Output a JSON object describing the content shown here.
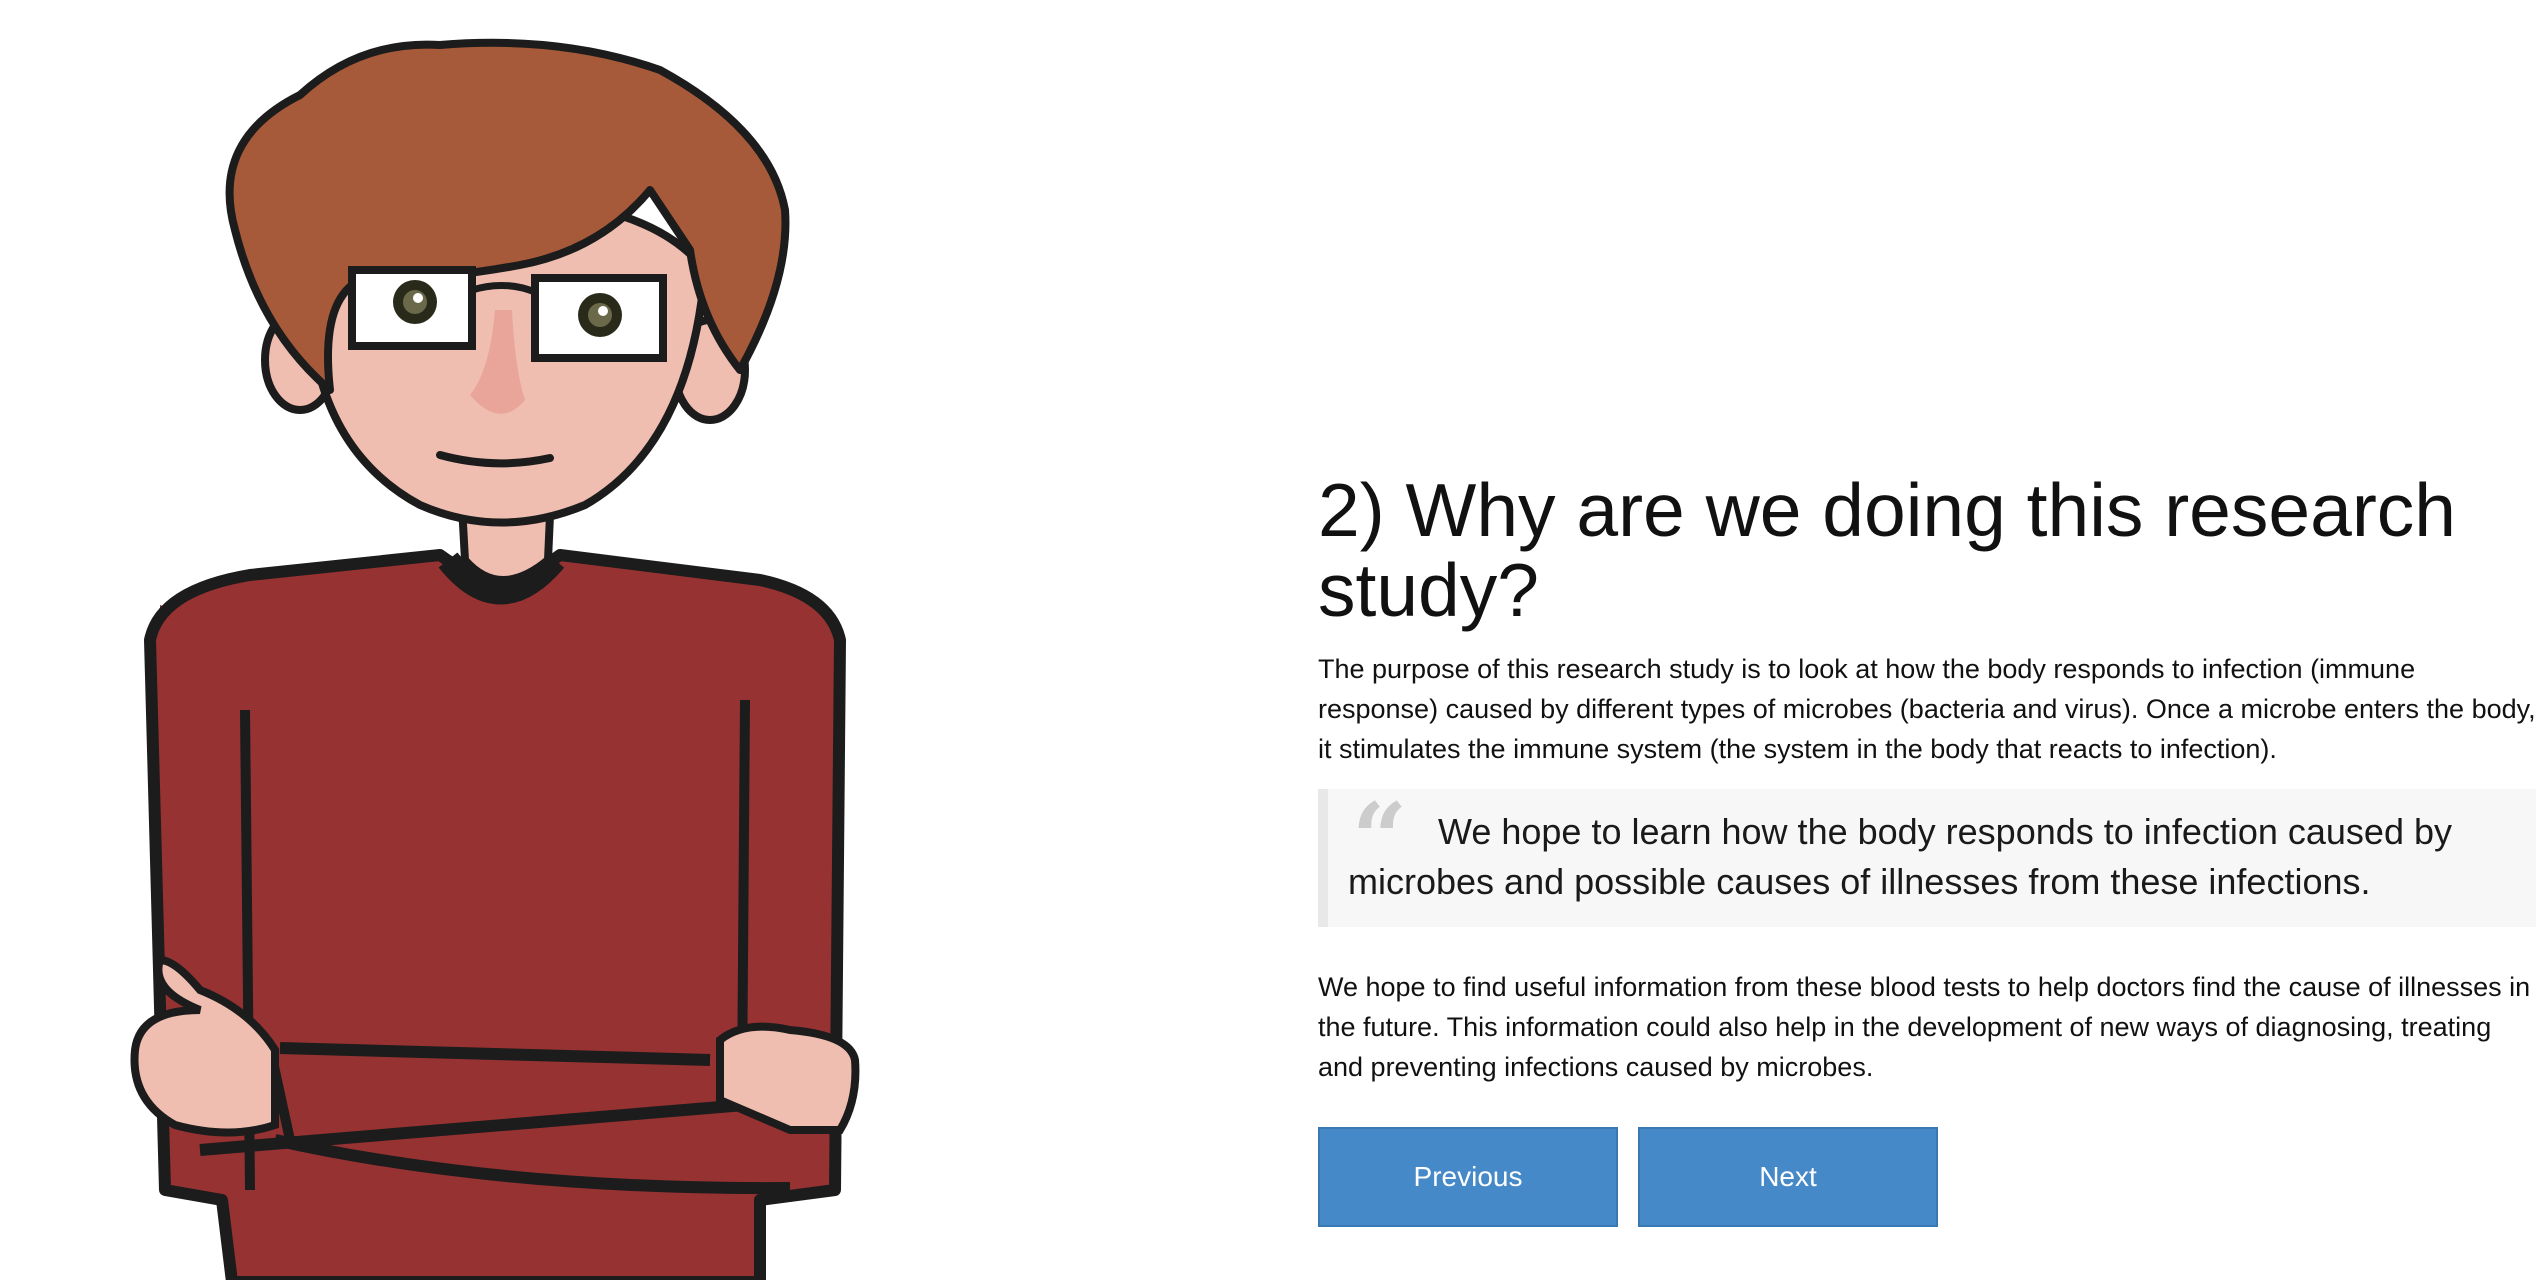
{
  "content": {
    "title": "2) Why are we doing this research study?",
    "paragraph1": "The purpose of this research study is to look at how the body responds to infection (immune response) caused by different types of microbes (bacteria and virus). Once a microbe enters the body, it stimulates the immune system (the system in the body that reacts to infection).",
    "quote": "We hope to learn how the body responds to infection caused by microbes and possible causes of illnesses from these infections.",
    "paragraph2": "We hope to find useful information from these blood tests to help doctors find the cause of illnesses in the future. This information could also help in the development of new ways of diagnosing, treating and preventing infections caused by microbes."
  },
  "navigation": {
    "previous_label": "Previous",
    "next_label": "Next"
  },
  "icons": {
    "quote_mark": "quote-icon"
  },
  "colors": {
    "button": "#4589c8",
    "shirt": "#963232",
    "hair": "#a65a3a",
    "skin": "#f0beb0",
    "quote_background": "#f7f7f7"
  }
}
